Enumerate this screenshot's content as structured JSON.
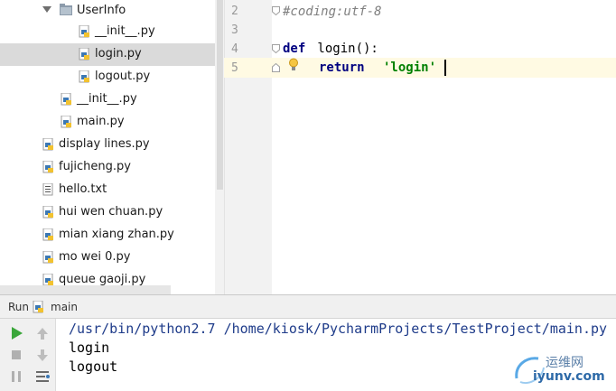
{
  "project_tree": {
    "items": [
      {
        "label": "UserInfo",
        "type": "folder"
      },
      {
        "label": "__init__.py",
        "type": "py"
      },
      {
        "label": "login.py",
        "type": "py"
      },
      {
        "label": "logout.py",
        "type": "py"
      },
      {
        "label": "__init__.py",
        "type": "py"
      },
      {
        "label": "main.py",
        "type": "py"
      },
      {
        "label": "display lines.py",
        "type": "py"
      },
      {
        "label": "fujicheng.py",
        "type": "py"
      },
      {
        "label": "hello.txt",
        "type": "txt"
      },
      {
        "label": "hui wen chuan.py",
        "type": "py"
      },
      {
        "label": "mian xiang zhan.py",
        "type": "py"
      },
      {
        "label": "mo wei 0.py",
        "type": "py"
      },
      {
        "label": "queue gaoji.py",
        "type": "py"
      }
    ],
    "selected_index": 2
  },
  "editor": {
    "line_numbers": [
      "2",
      "3",
      "4",
      "5"
    ],
    "comment": "#coding:utf-8",
    "def_keyword": "def",
    "def_signature": " login():",
    "return_keyword": "return",
    "return_value": "'login'"
  },
  "run_panel": {
    "tab_label": "Run",
    "config_name": "main",
    "console_lines": [
      "/usr/bin/python2.7 /home/kiosk/PycharmProjects/TestProject/main.py",
      "login",
      "logout"
    ]
  },
  "watermark": {
    "cn_text": "运维网",
    "site": "iyunv.com"
  },
  "colors": {
    "keyword": "#000080",
    "string": "#008000",
    "comment": "#808080",
    "selection": "#dadada",
    "run_green": "#3aa63a"
  }
}
